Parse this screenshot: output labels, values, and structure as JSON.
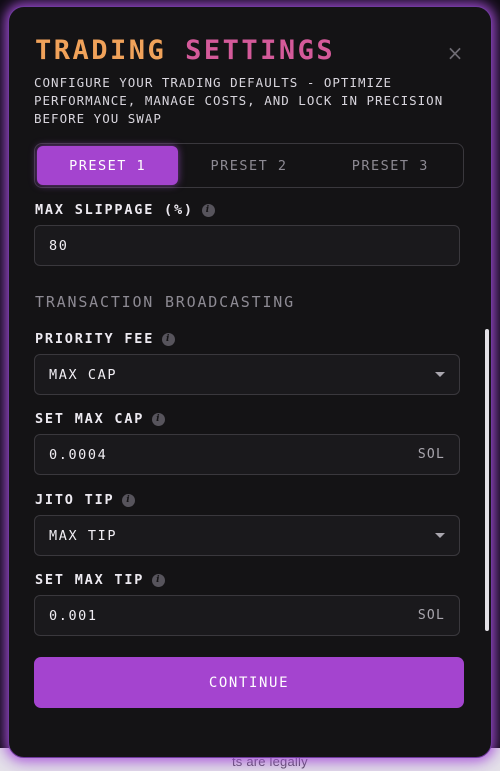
{
  "backdrop": {
    "text": "ts are legally"
  },
  "modal": {
    "title_part1": "TRADING",
    "title_part2": "SETTINGS",
    "close_label": "×",
    "subtitle": "CONFIGURE YOUR TRADING DEFAULTS - OPTIMIZE PERFORMANCE, MANAGE COSTS, AND LOCK IN PRECISION BEFORE YOU SWAP"
  },
  "presets": {
    "tabs": [
      {
        "label": "PRESET 1",
        "active": true
      },
      {
        "label": "PRESET 2",
        "active": false
      },
      {
        "label": "PRESET 3",
        "active": false
      }
    ]
  },
  "slippage": {
    "label": "MAX SLIPPAGE (%)",
    "value": "80"
  },
  "broadcasting": {
    "heading": "TRANSACTION BROADCASTING",
    "priority_fee": {
      "label": "PRIORITY FEE",
      "selected": "MAX CAP"
    },
    "max_cap": {
      "label": "SET MAX CAP",
      "value": "0.0004",
      "unit": "SOL"
    },
    "jito_tip": {
      "label": "JITO TIP",
      "selected": "MAX TIP"
    },
    "max_tip": {
      "label": "SET MAX TIP",
      "value": "0.001",
      "unit": "SOL"
    }
  },
  "info_icon_glyph": "i",
  "actions": {
    "continue_label": "CONTINUE"
  },
  "colors": {
    "accent": "#a444cf",
    "title_orange": "#f0a25a",
    "title_pink": "#d45a9a",
    "modal_bg": "#141315"
  }
}
